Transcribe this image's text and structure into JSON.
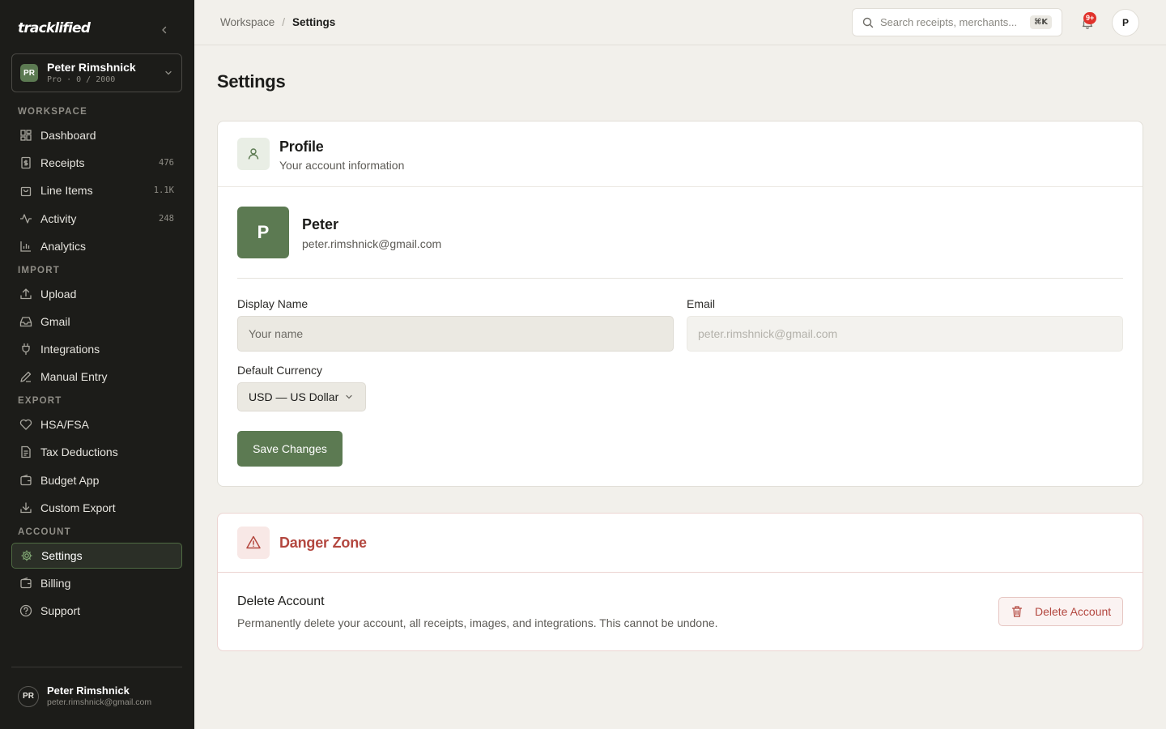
{
  "app": {
    "logo_text": "tracklified"
  },
  "account_switcher": {
    "initials": "PR",
    "name": "Peter Rimshnick",
    "plan": "Pro · 0 / 2000"
  },
  "sidebar": {
    "sections": {
      "workspace": "WORKSPACE",
      "import": "IMPORT",
      "export": "EXPORT",
      "account": "ACCOUNT"
    },
    "items": {
      "dashboard": {
        "label": "Dashboard"
      },
      "receipts": {
        "label": "Receipts",
        "count": "476"
      },
      "line_items": {
        "label": "Line Items",
        "count": "1.1K"
      },
      "activity": {
        "label": "Activity",
        "count": "248"
      },
      "analytics": {
        "label": "Analytics"
      },
      "upload": {
        "label": "Upload"
      },
      "gmail": {
        "label": "Gmail"
      },
      "integrations": {
        "label": "Integrations"
      },
      "manual_entry": {
        "label": "Manual Entry"
      },
      "hsa_fsa": {
        "label": "HSA/FSA"
      },
      "tax_deductions": {
        "label": "Tax Deductions"
      },
      "budget_app": {
        "label": "Budget App"
      },
      "custom_export": {
        "label": "Custom Export"
      },
      "settings": {
        "label": "Settings",
        "active": true
      },
      "billing": {
        "label": "Billing"
      },
      "support": {
        "label": "Support"
      }
    },
    "user": {
      "initials": "PR",
      "name": "Peter Rimshnick",
      "email": "peter.rimshnick@gmail.com"
    }
  },
  "topbar": {
    "breadcrumb": {
      "parent": "Workspace",
      "separator": "/",
      "current": "Settings"
    },
    "search": {
      "placeholder": "Search receipts, merchants...",
      "shortcut": "⌘K"
    },
    "notifications": {
      "badge": "9+"
    },
    "avatar_initial": "P"
  },
  "page": {
    "title": "Settings"
  },
  "profile_card": {
    "title": "Profile",
    "subtitle": "Your account information",
    "avatar_initial": "P",
    "name": "Peter",
    "email": "peter.rimshnick@gmail.com",
    "display_name_label": "Display Name",
    "display_name_value": "",
    "display_name_placeholder": "Your name",
    "email_label": "Email",
    "email_value": "peter.rimshnick@gmail.com",
    "currency_label": "Default Currency",
    "currency_value": "USD — US Dollar",
    "save_label": "Save Changes"
  },
  "danger_card": {
    "title": "Danger Zone",
    "delete_title": "Delete Account",
    "delete_description": "Permanently delete your account, all receipts, images, and integrations. This cannot be undone.",
    "delete_button": "Delete Account"
  },
  "colors": {
    "sidebar_bg": "#1c1c19",
    "accent_green": "#5c7a52",
    "danger_red": "#b3473f",
    "page_bg": "#f2f0eb"
  }
}
